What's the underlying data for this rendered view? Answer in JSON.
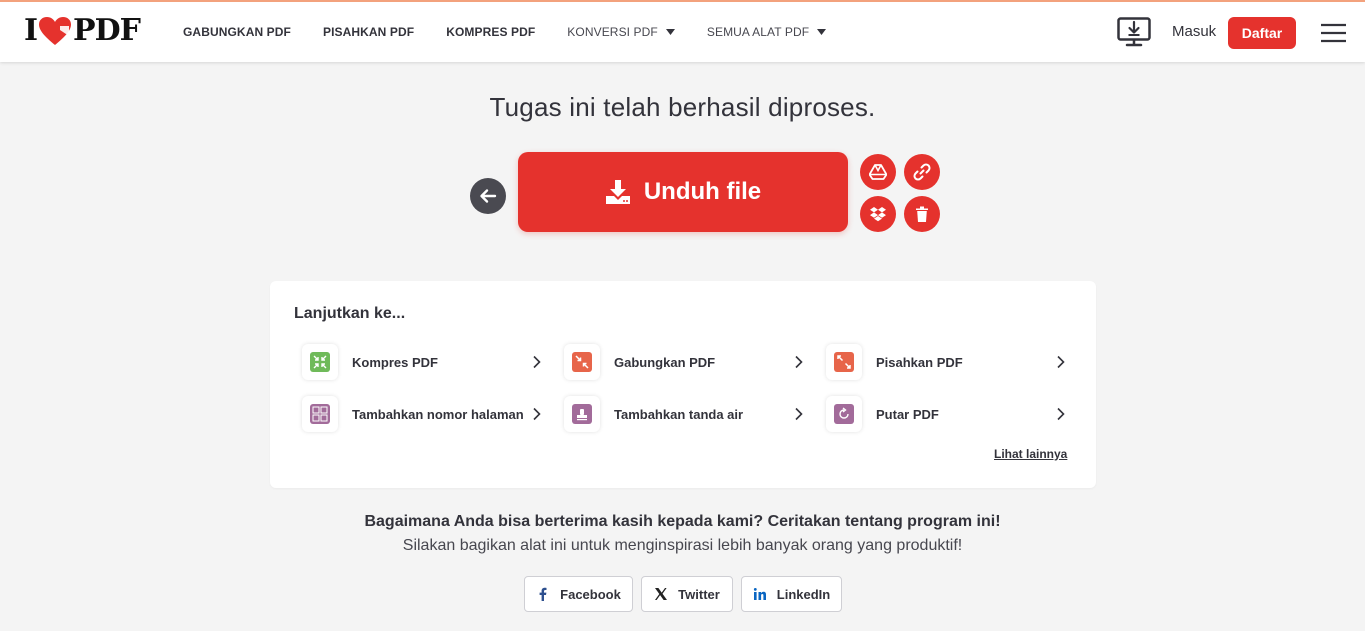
{
  "brand": {
    "logo_left": "I",
    "logo_right": "PDF",
    "accent": "#e5322d"
  },
  "nav": {
    "items": [
      {
        "label": "GABUNGKAN PDF"
      },
      {
        "label": "PISAHKAN PDF"
      },
      {
        "label": "KOMPRES PDF"
      },
      {
        "label": "KONVERSI PDF"
      },
      {
        "label": "SEMUA ALAT PDF"
      }
    ]
  },
  "header": {
    "login_label": "Masuk",
    "signup_label": "Daftar"
  },
  "main": {
    "title": "Tugas ini telah berhasil diproses.",
    "download_label": "Unduh file"
  },
  "continue": {
    "title": "Lanjutkan ke...",
    "tools": [
      {
        "label": "Kompres PDF",
        "color": "#6fba5a"
      },
      {
        "label": "Gabungkan PDF",
        "color": "#e7654a"
      },
      {
        "label": "Pisahkan PDF",
        "color": "#e7654a"
      },
      {
        "label": "Tambahkan nomor halaman",
        "color": "#a26b9a"
      },
      {
        "label": "Tambahkan tanda air",
        "color": "#a26b9a"
      },
      {
        "label": "Putar PDF",
        "color": "#a26b9a"
      }
    ],
    "see_more": "Lihat lainnya"
  },
  "footer": {
    "thanks": "Bagaimana Anda bisa berterima kasih kepada kami? Ceritakan tentang program ini!",
    "sub": "Silakan bagikan alat ini untuk menginspirasi lebih banyak orang yang produktif!",
    "share": [
      {
        "label": "Facebook"
      },
      {
        "label": "Twitter"
      },
      {
        "label": "LinkedIn"
      }
    ]
  }
}
